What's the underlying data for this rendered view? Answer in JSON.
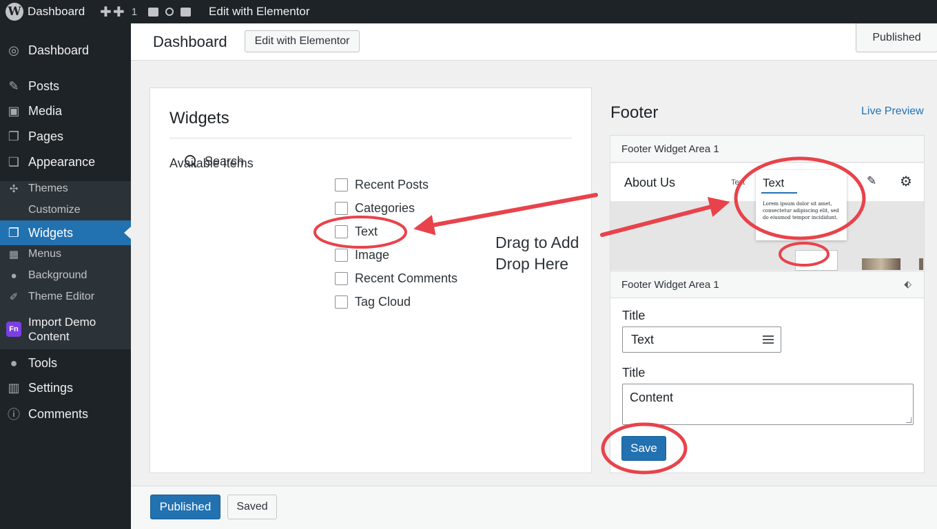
{
  "adminbar": {
    "site_name": "Dashboard",
    "new_count": "1",
    "edit_link": "Edit with Elementor"
  },
  "sidebar": {
    "items": [
      {
        "label": "Dashboard",
        "icon": "dashboard-icon"
      },
      {
        "label": "Posts",
        "icon": "pin-icon"
      },
      {
        "label": "Media",
        "icon": "media-icon"
      },
      {
        "label": "Pages",
        "icon": "pages-icon"
      },
      {
        "label": "Appearance",
        "icon": "appearance-icon"
      },
      {
        "label": "Themes",
        "icon": "themes-icon"
      },
      {
        "label": "Customize",
        "icon": ""
      },
      {
        "label": "Widgets",
        "icon": "widgets-icon"
      },
      {
        "label": "Menus",
        "icon": "menus-icon"
      },
      {
        "label": "Background",
        "icon": "background-icon"
      },
      {
        "label": "Theme Editor",
        "icon": "brush-icon"
      },
      {
        "label": "Import Demo Content",
        "icon": "fn-icon",
        "badge": "Fn"
      },
      {
        "label": "Tools",
        "icon": "tools-icon"
      },
      {
        "label": "Settings",
        "icon": "settings-icon"
      },
      {
        "label": "Comments",
        "icon": "info-icon"
      }
    ],
    "current": "Widgets"
  },
  "header": {
    "title": "Dashboard",
    "edit_button": "Edit with Elementor",
    "status_button": "Published"
  },
  "widgets": {
    "title": "Widgets",
    "available_label": "Available Items",
    "items": [
      "Search",
      "Recent Posts",
      "Categories",
      "Text",
      "Image",
      "Recent Comments",
      "Tag Cloud"
    ]
  },
  "annotation": {
    "line1": "Drag to Add",
    "line2": "Drop Here",
    "color": "#e8434b"
  },
  "footer_panel": {
    "title": "Footer",
    "live_preview": "Live Preview",
    "area1_label": "Footer Widget Area 1",
    "preview_about": "About Us",
    "preview_text_small": "Text",
    "popup_title": "Text",
    "popup_body": "Lorem ipsum dolor sit amet, consectetur adipiscing elit, sed do eiusmod tempor incididunt.",
    "area2_label": "Footer Widget Area 1",
    "title_label": "Title",
    "title_value": "Text",
    "content_label": "Title",
    "content_value": "Content",
    "save_button": "Save"
  },
  "bottom_bar": {
    "published_button": "Published",
    "saved_button": "Saved"
  },
  "colors": {
    "accent": "#2271b1",
    "sidebar_bg": "#1d2327",
    "annotation_red": "#e8434b"
  }
}
